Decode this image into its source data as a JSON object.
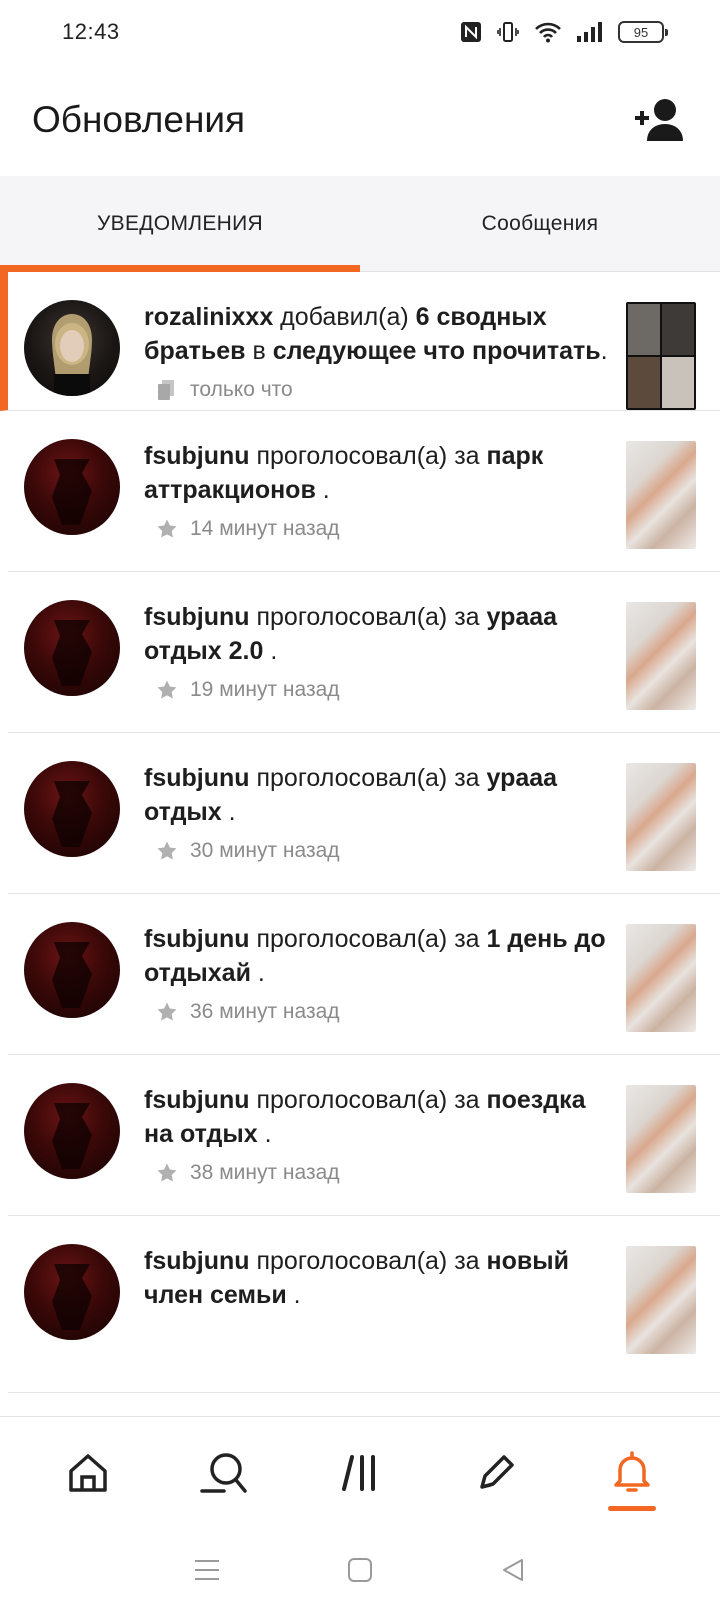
{
  "status_bar": {
    "time": "12:43",
    "battery": "95",
    "icons": [
      "nfc-icon",
      "vibrate-icon",
      "wifi-icon",
      "signal-icon",
      "battery-icon"
    ]
  },
  "header": {
    "title": "Обновления",
    "add_friend_icon": "add-person-icon"
  },
  "tabs": [
    {
      "label": "УВЕДОМЛЕНИЯ",
      "active": true
    },
    {
      "label": "Сообщения",
      "active": false
    }
  ],
  "colors": {
    "accent": "#f26722",
    "text": "#1e1e1e",
    "meta": "#8a8a8a"
  },
  "notifications": [
    {
      "user": "rozalinixxx",
      "action": " добавил(а) ",
      "object": "6 сводных братьев",
      "middle": " в ",
      "target": "следующее что прочитать",
      "suffix": ".",
      "time": "только что",
      "meta_icon": "reading-list-icon",
      "unread": true
    },
    {
      "user": "fsubjunu",
      "action": " проголосовал(а) за ",
      "object": "парк аттракционов",
      "suffix": " .",
      "time": "14 минут назад",
      "meta_icon": "star-icon"
    },
    {
      "user": "fsubjunu",
      "action": " проголосовал(а) за ",
      "object": "урааа отдых 2.0",
      "suffix": " .",
      "time": "19 минут назад",
      "meta_icon": "star-icon"
    },
    {
      "user": "fsubjunu",
      "action": " проголосовал(а) за ",
      "object": "урааа отдых",
      "suffix": " .",
      "time": "30 минут назад",
      "meta_icon": "star-icon"
    },
    {
      "user": "fsubjunu",
      "action": " проголосовал(а) за ",
      "object": "1 день до отдыхай",
      "suffix": " .",
      "time": "36 минут назад",
      "meta_icon": "star-icon"
    },
    {
      "user": "fsubjunu",
      "action": " проголосовал(а) за ",
      "object": "поездка на отдых",
      "suffix": " .",
      "time": "38 минут назад",
      "meta_icon": "star-icon"
    },
    {
      "user": "fsubjunu",
      "action": " проголосовал(а) за ",
      "object": "новый член семьи",
      "suffix": " .",
      "time": "",
      "meta_icon": "star-icon"
    }
  ],
  "bottom_nav": [
    {
      "icon": "home-icon",
      "active": false
    },
    {
      "icon": "search-icon",
      "active": false
    },
    {
      "icon": "library-icon",
      "active": false
    },
    {
      "icon": "pencil-icon",
      "active": false
    },
    {
      "icon": "bell-icon",
      "active": true
    }
  ],
  "system_nav": [
    "menu-icon",
    "home-square-icon",
    "back-icon"
  ]
}
